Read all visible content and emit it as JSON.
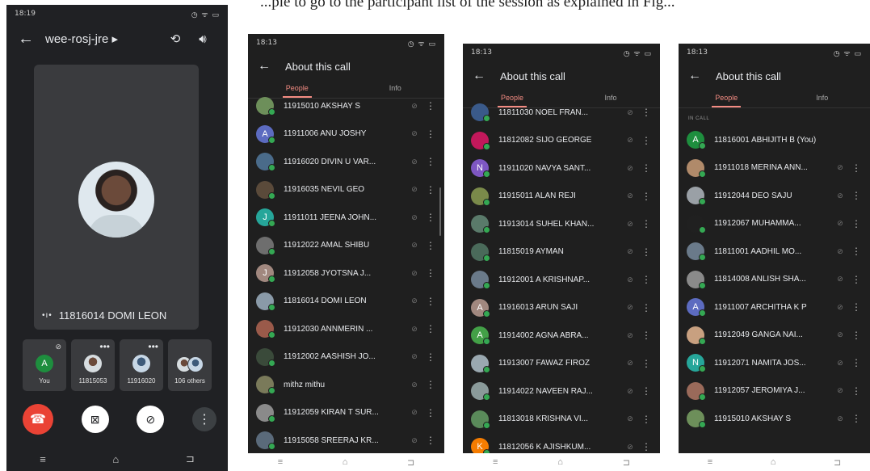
{
  "caption": "...ple to go to the participant list of the session as explained in Fig...",
  "phone1": {
    "status_time": "18:19",
    "status_right": "◷ ᯤ ▭",
    "meeting_code": "wee-rosj-jre ▸",
    "main_participant": "11816014 DOMI LEON",
    "thumbs": [
      {
        "label": "You",
        "initial": "A"
      },
      {
        "label": "11815053"
      },
      {
        "label": "11916020"
      },
      {
        "label": "106 others"
      }
    ]
  },
  "about": {
    "status_time": "18:13",
    "status_right": "◷ ᯤ ▭",
    "title": "About this call",
    "tab_people": "People",
    "tab_info": "Info",
    "in_call_label": "IN CALL"
  },
  "list2": [
    {
      "name": "11915010 AKSHAY S",
      "color": "#6d8f5a"
    },
    {
      "name": "11911006 ANU JOSHY",
      "initial": "A",
      "color": "#5c6bc0"
    },
    {
      "name": "11916020 DIVIN U VAR...",
      "color": "#4a6b8a"
    },
    {
      "name": "11916035 NEVIL GEO",
      "color": "#5a4a3a"
    },
    {
      "name": "11911011 JEENA JOHN...",
      "initial": "J",
      "color": "#26a69a"
    },
    {
      "name": "11912022 AMAL SHIBU",
      "color": "#6e6e6e"
    },
    {
      "name": "11912058 JYOTSNA J...",
      "initial": "J",
      "color": "#a1887f"
    },
    {
      "name": "11816014 DOMI LEON",
      "color": "#8a9aa8"
    },
    {
      "name": "11912030 ANNMERIN ...",
      "color": "#9a5a4a"
    },
    {
      "name": "11912002 AASHISH JO...",
      "color": "#3a4a3a"
    },
    {
      "name": "mithz mithu",
      "color": "#7a7a5a"
    },
    {
      "name": "11912059 KIRAN T SUR...",
      "color": "#8a8a8a"
    },
    {
      "name": "11915058 SREERAJ KR...",
      "color": "#5a6a7a"
    }
  ],
  "list3": [
    {
      "name": "11811030 NOEL FRAN...",
      "color": "#3a5a8a"
    },
    {
      "name": "11812082 SIJO GEORGE",
      "color": "#c2185b"
    },
    {
      "name": "11911020 NAVYA SANT...",
      "initial": "N",
      "color": "#7e57c2"
    },
    {
      "name": "11915011 ALAN REJI",
      "color": "#7a8a4a"
    },
    {
      "name": "11913014 SUHEL KHAN...",
      "color": "#5a7a6a"
    },
    {
      "name": "11815019 AYMAN",
      "color": "#4a6a5a"
    },
    {
      "name": "11912001 A KRISHNAP...",
      "color": "#6a7a8a"
    },
    {
      "name": "11916013 ARUN SAJI",
      "initial": "A",
      "color": "#a1887f"
    },
    {
      "name": "11914002 AGNA ABRA...",
      "initial": "A",
      "color": "#43a047"
    },
    {
      "name": "11913007 FAWAZ FIROZ",
      "color": "#9aa8b0"
    },
    {
      "name": "11914022 NAVEEN RAJ...",
      "color": "#8a9a9a"
    },
    {
      "name": "11813018 KRISHNA VI...",
      "color": "#5a8a5a"
    },
    {
      "name": "11812056 K AJISHKUM...",
      "initial": "K",
      "color": "#f57c00"
    }
  ],
  "list4": [
    {
      "name": "11816001 ABHIJITH B (You)",
      "initial": "A",
      "color": "#1e8e3e",
      "self": true
    },
    {
      "name": "11911018 MERINA ANN...",
      "color": "#b08a6a"
    },
    {
      "name": "11912044 DEO SAJU",
      "color": "#9aa0a6"
    },
    {
      "name": "11912067 MUHAMMA...",
      "color": "#202020"
    },
    {
      "name": "11811001 AADHIL MO...",
      "color": "#6a7a8a"
    },
    {
      "name": "11814008 ANLISH SHA...",
      "color": "#8a8a8a"
    },
    {
      "name": "11911007 ARCHITHA K P",
      "initial": "A",
      "color": "#5c6bc0"
    },
    {
      "name": "11912049 GANGA NAI...",
      "color": "#c8a080"
    },
    {
      "name": "11912071 NAMITA JOS...",
      "initial": "N",
      "color": "#26a69a"
    },
    {
      "name": "11912057 JEROMIYA J...",
      "color": "#9a6a5a"
    },
    {
      "name": "11915010 AKSHAY S",
      "color": "#6d8f5a"
    }
  ]
}
